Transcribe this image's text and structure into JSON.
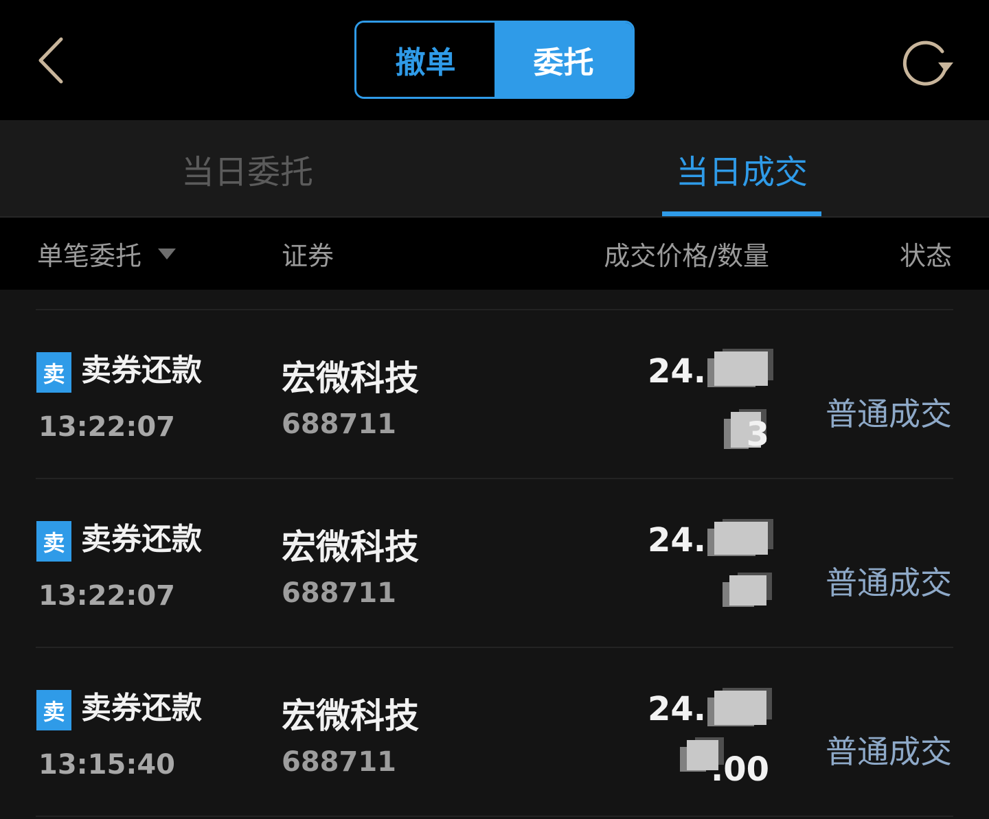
{
  "colors": {
    "accent": "#2f9be8",
    "background": "#141414",
    "topbar": "#000000",
    "status_text": "#8ea9c8",
    "back_icon": "#c8b59b"
  },
  "topbar": {
    "back_icon": "chevron-left-icon",
    "segment": {
      "left_label": "撤单",
      "right_label": "委托",
      "active": "right"
    },
    "refresh_icon": "refresh-icon"
  },
  "subtabs": [
    {
      "label": "当日委托",
      "active": false
    },
    {
      "label": "当日成交",
      "active": true
    }
  ],
  "columns": {
    "filter_label": "单笔委托",
    "filter_icon": "triangle-down-icon",
    "security": "证券",
    "price_qty": "成交价格/数量",
    "status": "状态"
  },
  "rows": [
    {
      "badge": "卖",
      "type": "卖券还款",
      "time": "13:22:07",
      "name": "宏微科技",
      "code": "688711",
      "price": "24.",
      "qty": "3",
      "status": "普通成交"
    },
    {
      "badge": "卖",
      "type": "卖券还款",
      "time": "13:22:07",
      "name": "宏微科技",
      "code": "688711",
      "price": "24.",
      "qty": "",
      "status": "普通成交"
    },
    {
      "badge": "卖",
      "type": "卖券还款",
      "time": "13:15:40",
      "name": "宏微科技",
      "code": "688711",
      "price": "24.",
      "qty": ".00",
      "status": "普通成交"
    }
  ]
}
